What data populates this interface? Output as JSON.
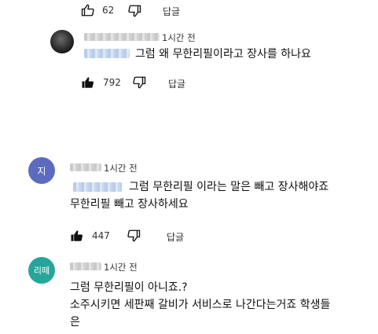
{
  "comments": [
    {
      "likes": "62",
      "reply_label": "답글"
    },
    {
      "time": "1시간 전",
      "text": "그럼 왜 무한리필이라고 장사를 하나요",
      "likes": "792",
      "reply_label": "답글"
    },
    {
      "avatar_text": "지",
      "time": "1시간 전",
      "text_line1": "그럼 무한리필 이라는 말은 빼고 장사해야죠",
      "text_line2": "무한리필 빼고 장사하세요",
      "likes": "447",
      "reply_label": "답글"
    },
    {
      "avatar_text": "리떼",
      "time": "1시간 전",
      "text_line1": "그럼 무한리필이 아니죠.?",
      "text_line2": "소주시키면 세판째 갈비가 서비스로 나간다는거죠 학생들",
      "text_line3": "은"
    }
  ],
  "colors": {
    "avatar_ji": "#5c6bc0",
    "avatar_ritte": "#26a69a"
  }
}
